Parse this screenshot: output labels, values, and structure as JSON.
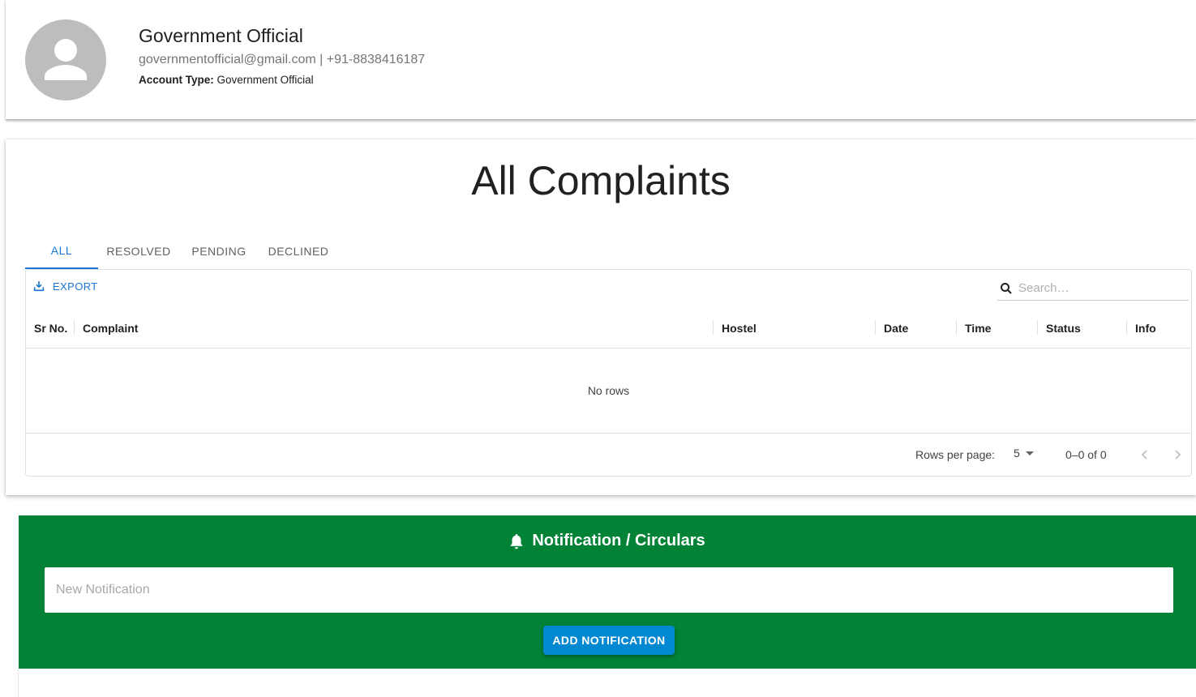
{
  "profile": {
    "name": "Government Official",
    "contact": "governmentofficial@gmail.com | +91-8838416187",
    "account_type_label": "Account Type:",
    "account_type_value": "Government Official",
    "avatar_icon": "person-icon"
  },
  "complaints": {
    "title": "All Complaints",
    "tabs": [
      {
        "label": "ALL",
        "active": true
      },
      {
        "label": "RESOLVED",
        "active": false
      },
      {
        "label": "PENDING",
        "active": false
      },
      {
        "label": "DECLINED",
        "active": false
      }
    ],
    "toolbar": {
      "export_label": "EXPORT",
      "export_icon": "download-icon",
      "search_placeholder": "Search…",
      "search_value": "",
      "search_icon": "search-icon"
    },
    "columns": [
      "Sr No.",
      "Complaint",
      "Hostel",
      "Date",
      "Time",
      "Status",
      "Info"
    ],
    "rows": [],
    "empty_text": "No rows",
    "pagination": {
      "rows_per_page_label": "Rows per page:",
      "rows_per_page_value": "5",
      "range_label": "0–0 of 0"
    }
  },
  "notifications": {
    "title": "Notification / Circulars",
    "title_icon": "bell-icon",
    "input_placeholder": "New Notification",
    "input_value": "",
    "add_button_label": "ADD NOTIFICATION",
    "background_color": "#018237",
    "button_color": "#0288d1"
  },
  "colors": {
    "accent": "#1976d2"
  }
}
